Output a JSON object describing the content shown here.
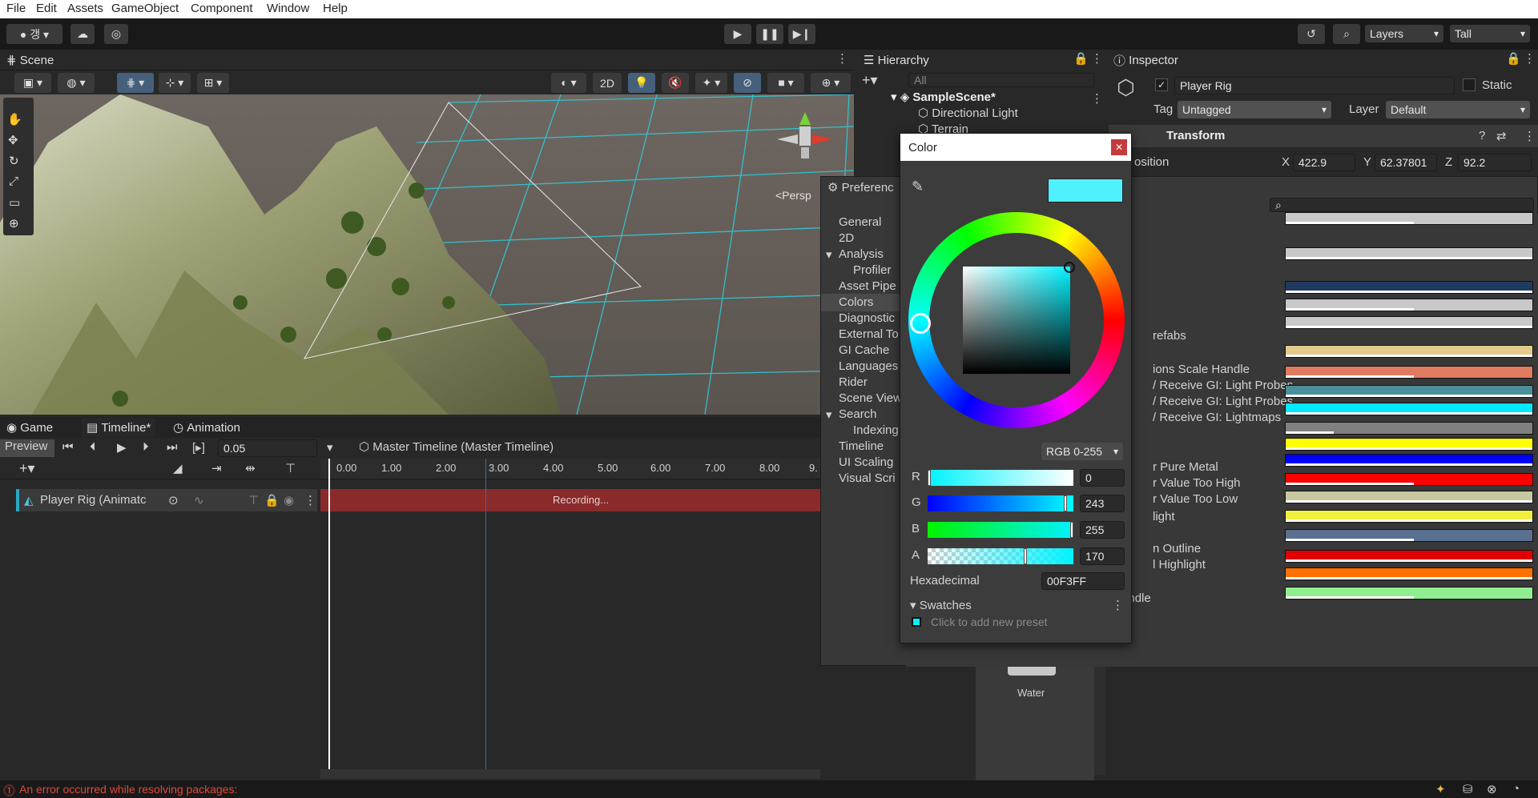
{
  "menu": [
    "File",
    "Edit",
    "Assets",
    "GameObject",
    "Component",
    "Window",
    "Help"
  ],
  "toolbar": {
    "layers_label": "Layers",
    "layout_label": "Tall"
  },
  "scene": {
    "tab_label": "Scene",
    "btn_2d": "2D",
    "persp_label": "<Persp"
  },
  "hierarchy": {
    "tab_label": "Hierarchy",
    "search_placeholder": "All",
    "scene_name": "SampleScene*",
    "items": [
      "Directional Light",
      "Terrain"
    ],
    "asset_labels": [
      "Water"
    ]
  },
  "inspector": {
    "tab_label": "Inspector",
    "object_name": "Player Rig",
    "static_label": "Static",
    "tag_label": "Tag",
    "tag_value": "Untagged",
    "layer_label": "Layer",
    "layer_value": "Default",
    "transform_label": "Transform",
    "position_label": "osition",
    "pos_x_label": "X",
    "pos_x": "422.9",
    "pos_y_label": "Y",
    "pos_y": "62.37801",
    "pos_z_label": "Z",
    "pos_z": "92.2"
  },
  "preferences": {
    "title": "Preferenc",
    "items": [
      "General",
      "2D",
      "Analysis",
      "Profiler",
      "Asset Pipe",
      "Colors",
      "Diagnostic",
      "External To",
      "GI Cache",
      "Languages",
      "Rider",
      "Scene View",
      "Search",
      "Indexing",
      "Timeline",
      "UI Scaling",
      "Visual Scri"
    ],
    "color_labels": [
      "refabs",
      "ions Scale Handle",
      "/ Receive GI: Light Probes",
      "/ Receive GI: Light Probes",
      "/ Receive GI: Lightmaps",
      "r Pure Metal",
      "r Value Too High",
      "r Value Too Low",
      "light",
      "n Outline",
      "l Highlight",
      "UI Collider Handle"
    ],
    "swatch_colors": [
      "#c8c8c8",
      "#c8c8c8",
      "#1e3a5f",
      "#c8c8c8",
      "#c8c8c8",
      "#e3c98a",
      "#e07a60",
      "#4a8f9a",
      "#00e8ff",
      "#808080",
      "#ffff00",
      "#0000ff",
      "#ff0000",
      "#c8c8a0",
      "#f0f040",
      "#5a7090",
      "#e00000",
      "#ff7000",
      "#90ee90"
    ]
  },
  "color_picker": {
    "title": "Color",
    "mode": "RGB 0-255",
    "r_label": "R",
    "r": "0",
    "g_label": "G",
    "g": "243",
    "b_label": "B",
    "b": "255",
    "a_label": "A",
    "a": "170",
    "hex_label": "Hexadecimal",
    "hex": "00F3FF",
    "swatches_label": "Swatches",
    "swatch_hint": "Click to add new preset",
    "current_color": "#4ff0ff"
  },
  "bottom_tabs": {
    "game": "Game",
    "timeline": "Timeline*",
    "animation": "Animation"
  },
  "timeline": {
    "preview_label": "Preview",
    "time_value": "0.05",
    "asset_name": "Master Timeline (Master Timeline)",
    "track_name": "Player Rig (Animatc",
    "recording_label": "Recording...",
    "ruler": [
      "0.00",
      "1.00",
      "2.00",
      "3.00",
      "4.00",
      "5.00",
      "6.00",
      "7.00",
      "8.00",
      "9."
    ]
  },
  "status": {
    "error_text": "An error occurred while resolving packages:"
  }
}
